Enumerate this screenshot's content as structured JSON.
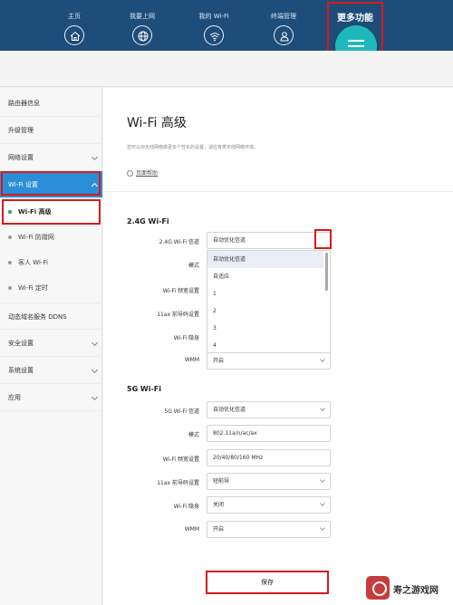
{
  "nav": {
    "items": [
      {
        "label": "主页",
        "icon": "home-icon"
      },
      {
        "label": "我要上网",
        "icon": "globe-icon"
      },
      {
        "label": "我的 Wi-Fi",
        "icon": "wifi-icon"
      },
      {
        "label": "终端管理",
        "icon": "user-icon"
      }
    ],
    "more_label": "更多功能",
    "more_icon": "menu-icon"
  },
  "sidebar": {
    "items": [
      {
        "label": "路由器信息"
      },
      {
        "label": "升级管理"
      },
      {
        "label": "网络设置"
      },
      {
        "label": "Wi-Fi 设置"
      }
    ],
    "sub_items": [
      {
        "label": "Wi-Fi 高级"
      },
      {
        "label": "Wi-Fi 防蹭网"
      },
      {
        "label": "客人 Wi-Fi"
      },
      {
        "label": "Wi-Fi 定时"
      }
    ],
    "bottom_items": [
      {
        "label": "动态域名服务 DDNS"
      },
      {
        "label": "安全设置"
      },
      {
        "label": "系统设置"
      },
      {
        "label": "应用"
      }
    ]
  },
  "main": {
    "title": "Wi-Fi 高级",
    "description": "您可以对无线网络做更多个性化的设置，适应各类无线网络环境。",
    "help_label": "页面帮助",
    "band24": {
      "title": "2.4G Wi-Fi",
      "labels": [
        "2.4G Wi-Fi 信道",
        "模式",
        "Wi-Fi 频宽设置",
        "11ax 前导码设置",
        "Wi-Fi 隐身",
        "WMM"
      ],
      "channel_value": "自动优化信道",
      "wmm_value": "开启",
      "dropdown_options": [
        "自动优化信道",
        "自适应",
        "1",
        "2",
        "3",
        "4"
      ]
    },
    "band5": {
      "title": "5G Wi-Fi",
      "labels": [
        "5G Wi-Fi 信道",
        "模式",
        "Wi-Fi 频宽设置",
        "11ax 前导码设置",
        "Wi-Fi 隐身",
        "WMM"
      ],
      "values": [
        "自动优化信道",
        "802.11a/n/ac/ax",
        "20/40/80/160 MHz",
        "短前导",
        "关闭",
        "开启"
      ]
    },
    "save_label": "保存"
  },
  "watermark": "寿之游戏网",
  "colors": {
    "header": "#1f4d7a",
    "accent": "#2a8fd6",
    "teal": "#1fb8ba",
    "highlight": "#d61a1a"
  }
}
